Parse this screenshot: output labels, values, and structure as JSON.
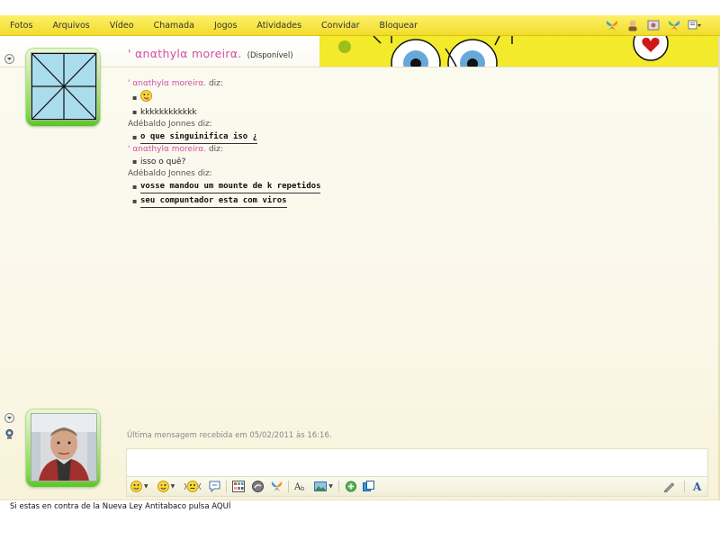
{
  "menu": {
    "items": [
      "Fotos",
      "Arquivos",
      "Vídeo",
      "Chamada",
      "Jogos",
      "Atividades",
      "Convidar",
      "Bloquear"
    ],
    "icons": [
      "butterfly-icon",
      "contact-card-icon",
      "photo-icon",
      "butterfly-alt-icon",
      "options-dropdown-icon"
    ]
  },
  "header": {
    "contact_name": "' αnαthylα moreirα.",
    "status": "(Disponível)"
  },
  "conversation": [
    {
      "sender": "' αnαthylα moreirα.",
      "says": "diz:",
      "sender_color": "#d050a8",
      "messages": [
        {
          "text": "",
          "emoticon": "tongue-wink-emoticon"
        },
        {
          "text": "kkkkkkkkkkkk"
        }
      ]
    },
    {
      "sender": "Adébaldo Jonnes",
      "says": "diz:",
      "sender_color": "#666666",
      "messages": [
        {
          "text": "o que singuinifica iso ¿",
          "style": "handwriting"
        }
      ]
    },
    {
      "sender": "' αnαthylα moreirα.",
      "says": "diz:",
      "sender_color": "#d050a8",
      "messages": [
        {
          "text": "isso o quê?"
        }
      ]
    },
    {
      "sender": "Adébaldo Jonnes",
      "says": "diz:",
      "sender_color": "#666666",
      "messages": [
        {
          "text": "vosse mandou um mounte de k repetidos",
          "style": "handwriting"
        },
        {
          "text": "seu compuntador esta com viros",
          "style": "handwriting"
        }
      ]
    }
  ],
  "footer": {
    "last_message": "Última mensagem recebida em 05/02/2011 às 16:16.",
    "input_value": "",
    "toolbar_icons": [
      "emoticon-icon",
      "wink-icon",
      "nudge-icon",
      "voice-clip-icon",
      "background-icon",
      "handwriting-icon",
      "wink-anim-icon",
      "font-icon",
      "image-icon",
      "games-icon",
      "share-icon"
    ],
    "right_icons": [
      "pen-icon",
      "font-color-icon"
    ],
    "ad_text": "Si estas en contra de la Nueva Ley Antitabaco pulsa AQUÍ"
  },
  "colors": {
    "menubar": "#f6e548",
    "accent_pink": "#d050a8",
    "avatar_frame": "#7fd84a"
  }
}
